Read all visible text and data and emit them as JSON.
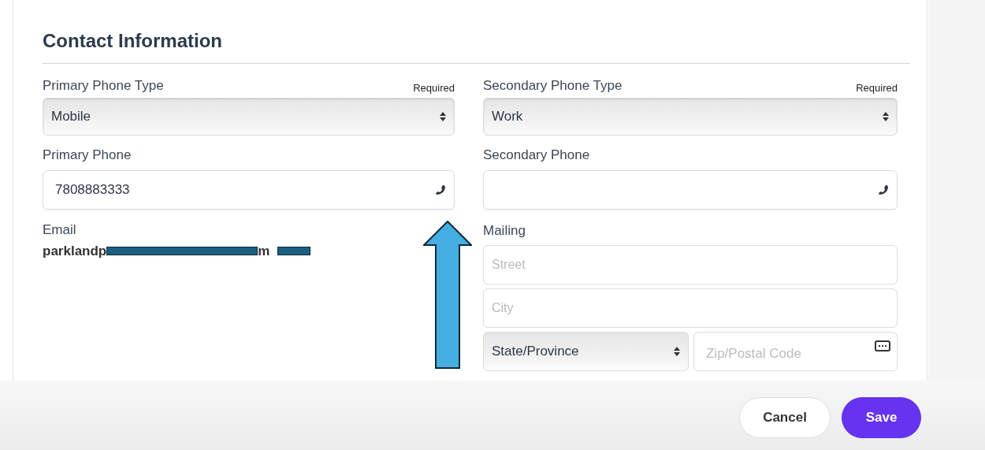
{
  "section_title": "Contact Information",
  "left": {
    "type_label": "Primary Phone Type",
    "required": "Required",
    "type_value": "Mobile",
    "phone_label": "Primary Phone",
    "phone_value": "7808883333"
  },
  "right": {
    "type_label": "Secondary Phone Type",
    "required": "Required",
    "type_value": "Work",
    "phone_label": "Secondary Phone"
  },
  "email": {
    "label": "Email",
    "value_parts": [
      "parklandp",
      "m"
    ]
  },
  "mailing": {
    "label": "Mailing",
    "street_placeholder": "Street",
    "city_placeholder": "City",
    "state_value": "State/Province",
    "zip_placeholder": "Zip/Postal Code"
  },
  "buttons": [
    {
      "label": "Cancel",
      "kind": "secondary"
    },
    {
      "label": "Save",
      "kind": "primary"
    }
  ]
}
